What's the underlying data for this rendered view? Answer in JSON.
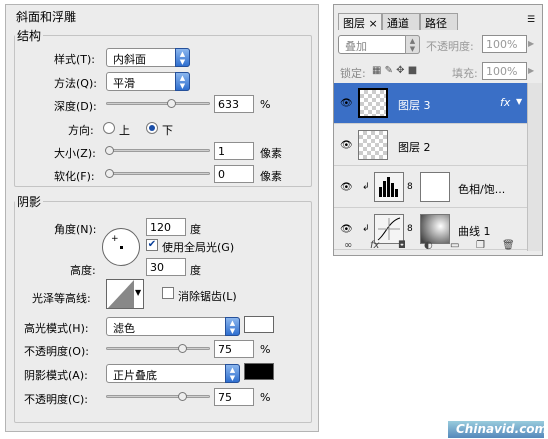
{
  "bevel": {
    "title": "斜面和浮雕",
    "structure": {
      "legend": "结构",
      "style_label": "样式(T):",
      "style_value": "内斜面",
      "technique_label": "方法(Q):",
      "technique_value": "平滑",
      "depth_label": "深度(D):",
      "depth_value": "633",
      "depth_unit": "%",
      "direction_label": "方向:",
      "dir_up": "上",
      "dir_down": "下",
      "size_label": "大小(Z):",
      "size_value": "1",
      "size_unit": "像素",
      "soften_label": "软化(F):",
      "soften_value": "0",
      "soften_unit": "像素"
    },
    "shading": {
      "legend": "阴影",
      "angle_label": "角度(N):",
      "angle_value": "120",
      "angle_unit": "度",
      "global_light_label": "使用全局光(G)",
      "altitude_label": "高度:",
      "altitude_value": "30",
      "altitude_unit": "度",
      "gloss_label": "光泽等高线:",
      "antialias_label": "消除锯齿(L)",
      "highlight_mode_label": "高光模式(H):",
      "highlight_mode_value": "滤色",
      "highlight_color": "#ffffff",
      "highlight_opacity_label": "不透明度(O):",
      "highlight_opacity_value": "75",
      "shadow_mode_label": "阴影模式(A):",
      "shadow_mode_value": "正片叠底",
      "shadow_color": "#000000",
      "shadow_opacity_label": "不透明度(C):",
      "shadow_opacity_value": "75",
      "percent": "%"
    }
  },
  "layers": {
    "tabs": [
      "图层",
      "通道",
      "路径"
    ],
    "blend_mode": "叠加",
    "opacity_label": "不透明度:",
    "opacity_value": "100%",
    "lock_label": "锁定:",
    "fill_label": "填充:",
    "fill_value": "100%",
    "items": [
      {
        "name": "图层 3",
        "fx": "fx"
      },
      {
        "name": "图层 2"
      },
      {
        "name": "色相/饱..."
      },
      {
        "name": "曲线 1"
      }
    ]
  },
  "watermark": "Chinavid.com"
}
